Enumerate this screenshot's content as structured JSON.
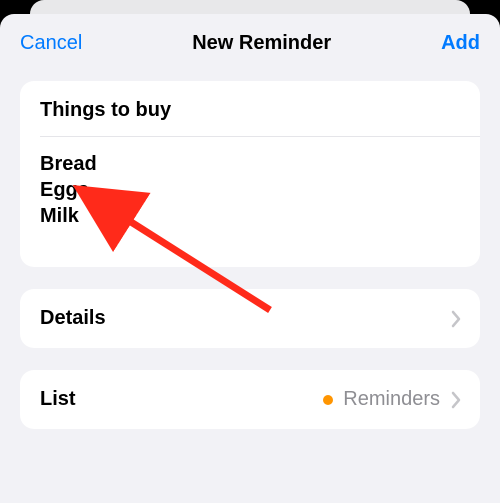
{
  "header": {
    "cancel_label": "Cancel",
    "title": "New Reminder",
    "add_label": "Add"
  },
  "reminder": {
    "title": "Things to buy",
    "notes": [
      "Bread",
      "Eggs",
      "Milk"
    ]
  },
  "details": {
    "label": "Details"
  },
  "list": {
    "label": "List",
    "value": "Reminders",
    "dot_color": "#ff9500"
  },
  "annotation": {
    "arrow_color": "#ff2a1a"
  }
}
